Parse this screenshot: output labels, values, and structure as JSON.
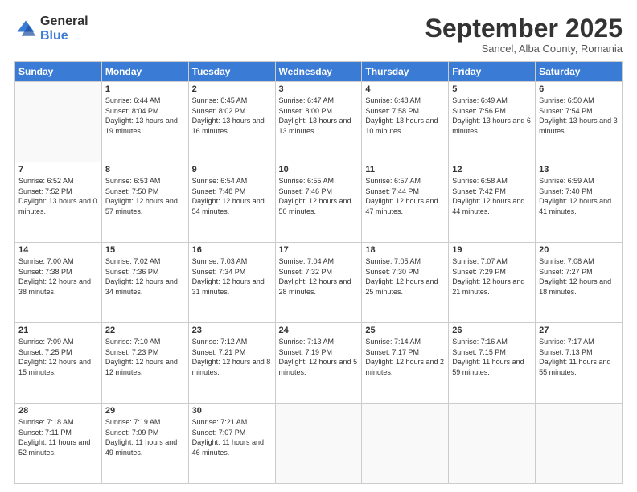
{
  "logo": {
    "general": "General",
    "blue": "Blue"
  },
  "header": {
    "title": "September 2025",
    "subtitle": "Sancel, Alba County, Romania"
  },
  "weekdays": [
    "Sunday",
    "Monday",
    "Tuesday",
    "Wednesday",
    "Thursday",
    "Friday",
    "Saturday"
  ],
  "weeks": [
    [
      {
        "day": "",
        "sunrise": "",
        "sunset": "",
        "daylight": ""
      },
      {
        "day": "1",
        "sunrise": "6:44 AM",
        "sunset": "8:04 PM",
        "daylight": "13 hours and 19 minutes."
      },
      {
        "day": "2",
        "sunrise": "6:45 AM",
        "sunset": "8:02 PM",
        "daylight": "13 hours and 16 minutes."
      },
      {
        "day": "3",
        "sunrise": "6:47 AM",
        "sunset": "8:00 PM",
        "daylight": "13 hours and 13 minutes."
      },
      {
        "day": "4",
        "sunrise": "6:48 AM",
        "sunset": "7:58 PM",
        "daylight": "13 hours and 10 minutes."
      },
      {
        "day": "5",
        "sunrise": "6:49 AM",
        "sunset": "7:56 PM",
        "daylight": "13 hours and 6 minutes."
      },
      {
        "day": "6",
        "sunrise": "6:50 AM",
        "sunset": "7:54 PM",
        "daylight": "13 hours and 3 minutes."
      }
    ],
    [
      {
        "day": "7",
        "sunrise": "6:52 AM",
        "sunset": "7:52 PM",
        "daylight": "13 hours and 0 minutes."
      },
      {
        "day": "8",
        "sunrise": "6:53 AM",
        "sunset": "7:50 PM",
        "daylight": "12 hours and 57 minutes."
      },
      {
        "day": "9",
        "sunrise": "6:54 AM",
        "sunset": "7:48 PM",
        "daylight": "12 hours and 54 minutes."
      },
      {
        "day": "10",
        "sunrise": "6:55 AM",
        "sunset": "7:46 PM",
        "daylight": "12 hours and 50 minutes."
      },
      {
        "day": "11",
        "sunrise": "6:57 AM",
        "sunset": "7:44 PM",
        "daylight": "12 hours and 47 minutes."
      },
      {
        "day": "12",
        "sunrise": "6:58 AM",
        "sunset": "7:42 PM",
        "daylight": "12 hours and 44 minutes."
      },
      {
        "day": "13",
        "sunrise": "6:59 AM",
        "sunset": "7:40 PM",
        "daylight": "12 hours and 41 minutes."
      }
    ],
    [
      {
        "day": "14",
        "sunrise": "7:00 AM",
        "sunset": "7:38 PM",
        "daylight": "12 hours and 38 minutes."
      },
      {
        "day": "15",
        "sunrise": "7:02 AM",
        "sunset": "7:36 PM",
        "daylight": "12 hours and 34 minutes."
      },
      {
        "day": "16",
        "sunrise": "7:03 AM",
        "sunset": "7:34 PM",
        "daylight": "12 hours and 31 minutes."
      },
      {
        "day": "17",
        "sunrise": "7:04 AM",
        "sunset": "7:32 PM",
        "daylight": "12 hours and 28 minutes."
      },
      {
        "day": "18",
        "sunrise": "7:05 AM",
        "sunset": "7:30 PM",
        "daylight": "12 hours and 25 minutes."
      },
      {
        "day": "19",
        "sunrise": "7:07 AM",
        "sunset": "7:29 PM",
        "daylight": "12 hours and 21 minutes."
      },
      {
        "day": "20",
        "sunrise": "7:08 AM",
        "sunset": "7:27 PM",
        "daylight": "12 hours and 18 minutes."
      }
    ],
    [
      {
        "day": "21",
        "sunrise": "7:09 AM",
        "sunset": "7:25 PM",
        "daylight": "12 hours and 15 minutes."
      },
      {
        "day": "22",
        "sunrise": "7:10 AM",
        "sunset": "7:23 PM",
        "daylight": "12 hours and 12 minutes."
      },
      {
        "day": "23",
        "sunrise": "7:12 AM",
        "sunset": "7:21 PM",
        "daylight": "12 hours and 8 minutes."
      },
      {
        "day": "24",
        "sunrise": "7:13 AM",
        "sunset": "7:19 PM",
        "daylight": "12 hours and 5 minutes."
      },
      {
        "day": "25",
        "sunrise": "7:14 AM",
        "sunset": "7:17 PM",
        "daylight": "12 hours and 2 minutes."
      },
      {
        "day": "26",
        "sunrise": "7:16 AM",
        "sunset": "7:15 PM",
        "daylight": "11 hours and 59 minutes."
      },
      {
        "day": "27",
        "sunrise": "7:17 AM",
        "sunset": "7:13 PM",
        "daylight": "11 hours and 55 minutes."
      }
    ],
    [
      {
        "day": "28",
        "sunrise": "7:18 AM",
        "sunset": "7:11 PM",
        "daylight": "11 hours and 52 minutes."
      },
      {
        "day": "29",
        "sunrise": "7:19 AM",
        "sunset": "7:09 PM",
        "daylight": "11 hours and 49 minutes."
      },
      {
        "day": "30",
        "sunrise": "7:21 AM",
        "sunset": "7:07 PM",
        "daylight": "11 hours and 46 minutes."
      },
      {
        "day": "",
        "sunrise": "",
        "sunset": "",
        "daylight": ""
      },
      {
        "day": "",
        "sunrise": "",
        "sunset": "",
        "daylight": ""
      },
      {
        "day": "",
        "sunrise": "",
        "sunset": "",
        "daylight": ""
      },
      {
        "day": "",
        "sunrise": "",
        "sunset": "",
        "daylight": ""
      }
    ]
  ]
}
